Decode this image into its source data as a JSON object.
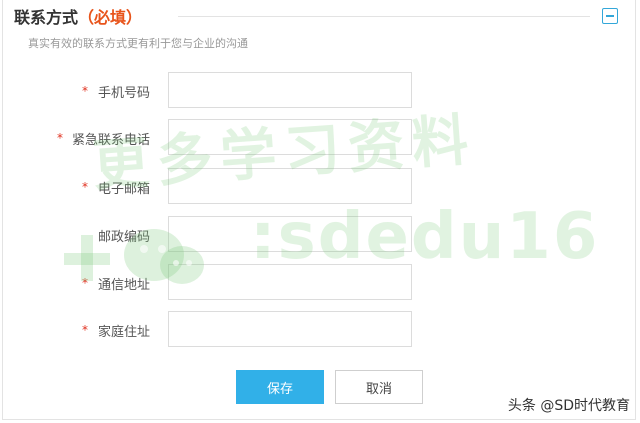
{
  "section": {
    "title": "联系方式",
    "required_tag": "（必填）",
    "subtitle": "真实有效的联系方式更有利于您与企业的沟通"
  },
  "fields": [
    {
      "label": "手机号码",
      "required": "*",
      "value": ""
    },
    {
      "label": "紧急联系电话",
      "required": "*",
      "value": ""
    },
    {
      "label": "电子邮箱",
      "required": "*",
      "value": ""
    },
    {
      "label": "邮政编码",
      "required": "",
      "value": ""
    },
    {
      "label": "通信地址",
      "required": "*",
      "value": ""
    },
    {
      "label": "家庭住址",
      "required": "*",
      "value": ""
    }
  ],
  "buttons": {
    "save": "保存",
    "cancel": "取消"
  },
  "watermark": {
    "text": "更多学习资料",
    "id": ":sdedu16",
    "footer": "头条 @SD时代教育"
  },
  "colors": {
    "accent": "#31b0e8",
    "required": "#e0301e",
    "title_tag": "#e8541b",
    "watermark": "#78c878"
  },
  "icons": {
    "collapse": "minus-square-icon",
    "watermark_logo": "wechat-icon"
  }
}
